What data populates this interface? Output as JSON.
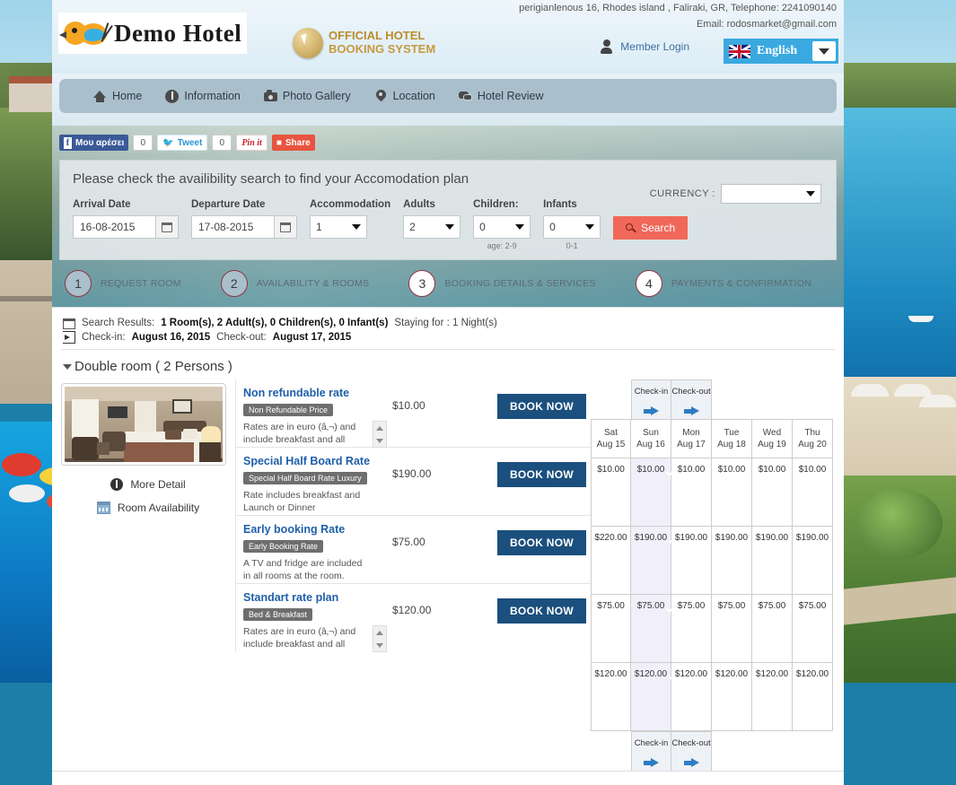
{
  "header": {
    "contact": "perigianlenous 16, Rhodes island , Faliraki, GR,  Telephone: 2241090140",
    "email": "Email: rodosmarket@gmail.com",
    "logo_text": "Demo Hotel",
    "badge_line1": "OFFICIAL HOTEL",
    "badge_line2": "BOOKING SYSTEM",
    "member_login": "Member Login",
    "language": "English"
  },
  "nav": {
    "items": [
      {
        "label": "Home",
        "icon": "home-icon"
      },
      {
        "label": "Information",
        "icon": "info-icon"
      },
      {
        "label": "Photo Gallery",
        "icon": "camera-icon"
      },
      {
        "label": "Location",
        "icon": "pin-icon"
      },
      {
        "label": "Hotel Review",
        "icon": "chat-icon"
      }
    ]
  },
  "social": {
    "facebook_label": "Μου αρέσει",
    "facebook_count": "0",
    "twitter_label": "Tweet",
    "twitter_count": "0",
    "pinterest_label": "Pin it",
    "share_label": "Share"
  },
  "search": {
    "title": "Please check the availibility search to find your Accomodation plan",
    "currency_label": "CURRENCY :",
    "currency_value": "",
    "arrival_label": "Arrival Date",
    "arrival_value": "16-08-2015",
    "departure_label": "Departure Date",
    "departure_value": "17-08-2015",
    "accommodation_label": "Accommodation",
    "accommodation_value": "1",
    "adults_label": "Adults",
    "adults_value": "2",
    "children_label": "Children:",
    "children_value": "0",
    "children_hint": "age: 2-9",
    "infants_label": "Infants",
    "infants_value": "0",
    "infants_hint": "0-1",
    "search_button": "Search"
  },
  "steps": [
    {
      "num": "1",
      "label": "REQUEST ROOM",
      "active": true
    },
    {
      "num": "2",
      "label": "AVAILABILITY & ROOMS",
      "active": true
    },
    {
      "num": "3",
      "label": "BOOKING DETAILS & SERVICES",
      "active": false
    },
    {
      "num": "4",
      "label": "PAYMENTS & CONFIRMATION",
      "active": false
    }
  ],
  "results": {
    "summary_prefix": "Search Results:",
    "summary_rooms": "1 Room(s), 2 Adult(s), 0 Children(s), 0 Infant(s)",
    "summary_staying": "Staying for : 1 Night(s)",
    "checkin_prefix": "Check-in:",
    "checkin_date": "August 16, 2015",
    "checkout_prefix": "Check-out:",
    "checkout_date": "August 17, 2015",
    "room_title": "Double room  ( 2 Persons )",
    "more_detail": "More Detail",
    "room_availability": "Room Availability",
    "checkin_col_label": "Check-in",
    "checkout_col_label": "Check-out",
    "days": [
      {
        "dow": "Sat",
        "date": "Aug 15"
      },
      {
        "dow": "Sun",
        "date": "Aug 16"
      },
      {
        "dow": "Mon",
        "date": "Aug 17"
      },
      {
        "dow": "Tue",
        "date": "Aug 18"
      },
      {
        "dow": "Wed",
        "date": "Aug 19"
      },
      {
        "dow": "Thu",
        "date": "Aug 20"
      }
    ],
    "selected_day_index": 1,
    "book_label": "BOOK NOW",
    "rates": [
      {
        "name": "Non refundable rate",
        "badge": "Non Refundable Price",
        "description": "Rates are in euro (â‚¬) and include breakfast and all applicable taxes.",
        "price": "$10.00",
        "has_spinner": true,
        "daily": [
          "$10.00",
          "$10.00",
          "$10.00",
          "$10.00",
          "$10.00",
          "$10.00"
        ]
      },
      {
        "name": "Special Half Board Rate",
        "badge": "Special Half Board Rate Luxury",
        "description": "Rate includes breakfast and Launch or Dinner",
        "price": "$190.00",
        "has_spinner": false,
        "daily": [
          "$220.00",
          "$190.00",
          "$190.00",
          "$190.00",
          "$190.00",
          "$190.00"
        ]
      },
      {
        "name": "Early booking Rate",
        "badge": "Early Booking Rate",
        "description": "A TV and fridge are included in all rooms at the room.",
        "price": "$75.00",
        "has_spinner": false,
        "daily": [
          "$75.00",
          "$75.00",
          "$75.00",
          "$75.00",
          "$75.00",
          "$75.00"
        ]
      },
      {
        "name": "Standart rate plan",
        "badge": "Bed & Breakfast",
        "description": "Rates are in euro (â‚¬) and include breakfast and all applicable taxes and service",
        "price": "$120.00",
        "has_spinner": true,
        "daily": [
          "$120.00",
          "$120.00",
          "$120.00",
          "$120.00",
          "$120.00",
          "$120.00"
        ]
      }
    ]
  },
  "colors": {
    "accent_blue": "#1b4f7d",
    "link_blue": "#1f5fa9",
    "search_red": "#f0685a",
    "lang_blue": "#3aa9e0",
    "check_teal": "#1b8fa0",
    "selected_col": "#f0effa"
  }
}
